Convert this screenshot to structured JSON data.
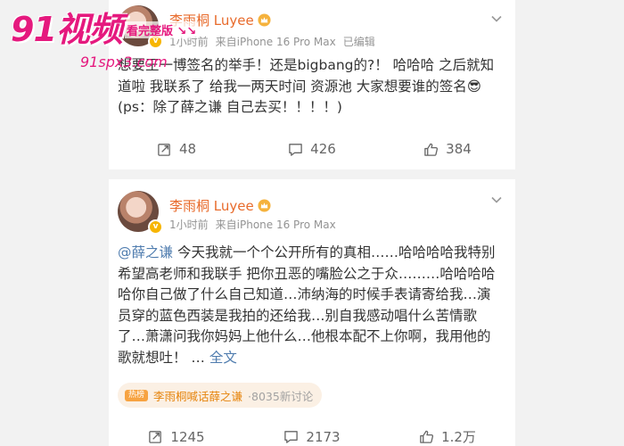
{
  "posts": [
    {
      "author": "李雨桐 Luyee",
      "time": "1小时前",
      "source": "来自iPhone 16 Pro Max",
      "edited": "已编辑",
      "text": "想要王一博签名的举手！还是bigbang的?！ 哈哈哈 之后就知道啦 我联系了 给我一两天时间 资源池 大家想要谁的签名😎(ps：除了薛之谦 自己去买！！！！)",
      "reposts": "48",
      "comments": "426",
      "likes": "384"
    },
    {
      "author": "李雨桐 Luyee",
      "time": "1小时前",
      "source": "来自iPhone 16 Pro Max",
      "mention": "@薛之谦",
      "text": " 今天我就一个个公开所有的真相……哈哈哈哈我特别希望高老师和我联手 把你丑恶的嘴脸公之于众………哈哈哈哈哈你自己做了什么自己知道…沛纳海的时候手表请寄给我…演员穿的蓝色西装是我拍的还给我…别自我感动唱什么苦情歌了…萧潇问我你妈妈上他什么…他根本配不上你啊，我用他的歌就想吐！ … ",
      "full_text": "全文",
      "topic_tag": "热榜",
      "topic": "李雨桐喊话薛之谦",
      "topic_count": "·8035新讨论",
      "reposts": "1245",
      "comments": "2173",
      "likes": "1.2万"
    }
  ],
  "watermark": {
    "logo": "91视频",
    "tag": "看完整版 ↘↘",
    "url": "91spx3.com"
  },
  "colors": {
    "author": "#e86b2c",
    "link": "#507daf",
    "topic": "#e6850e",
    "watermark": "#e5197e"
  },
  "icons": [
    "more-chevron-icon",
    "repost-icon",
    "comment-icon",
    "like-icon",
    "verified-badge-icon",
    "crown-icon"
  ]
}
